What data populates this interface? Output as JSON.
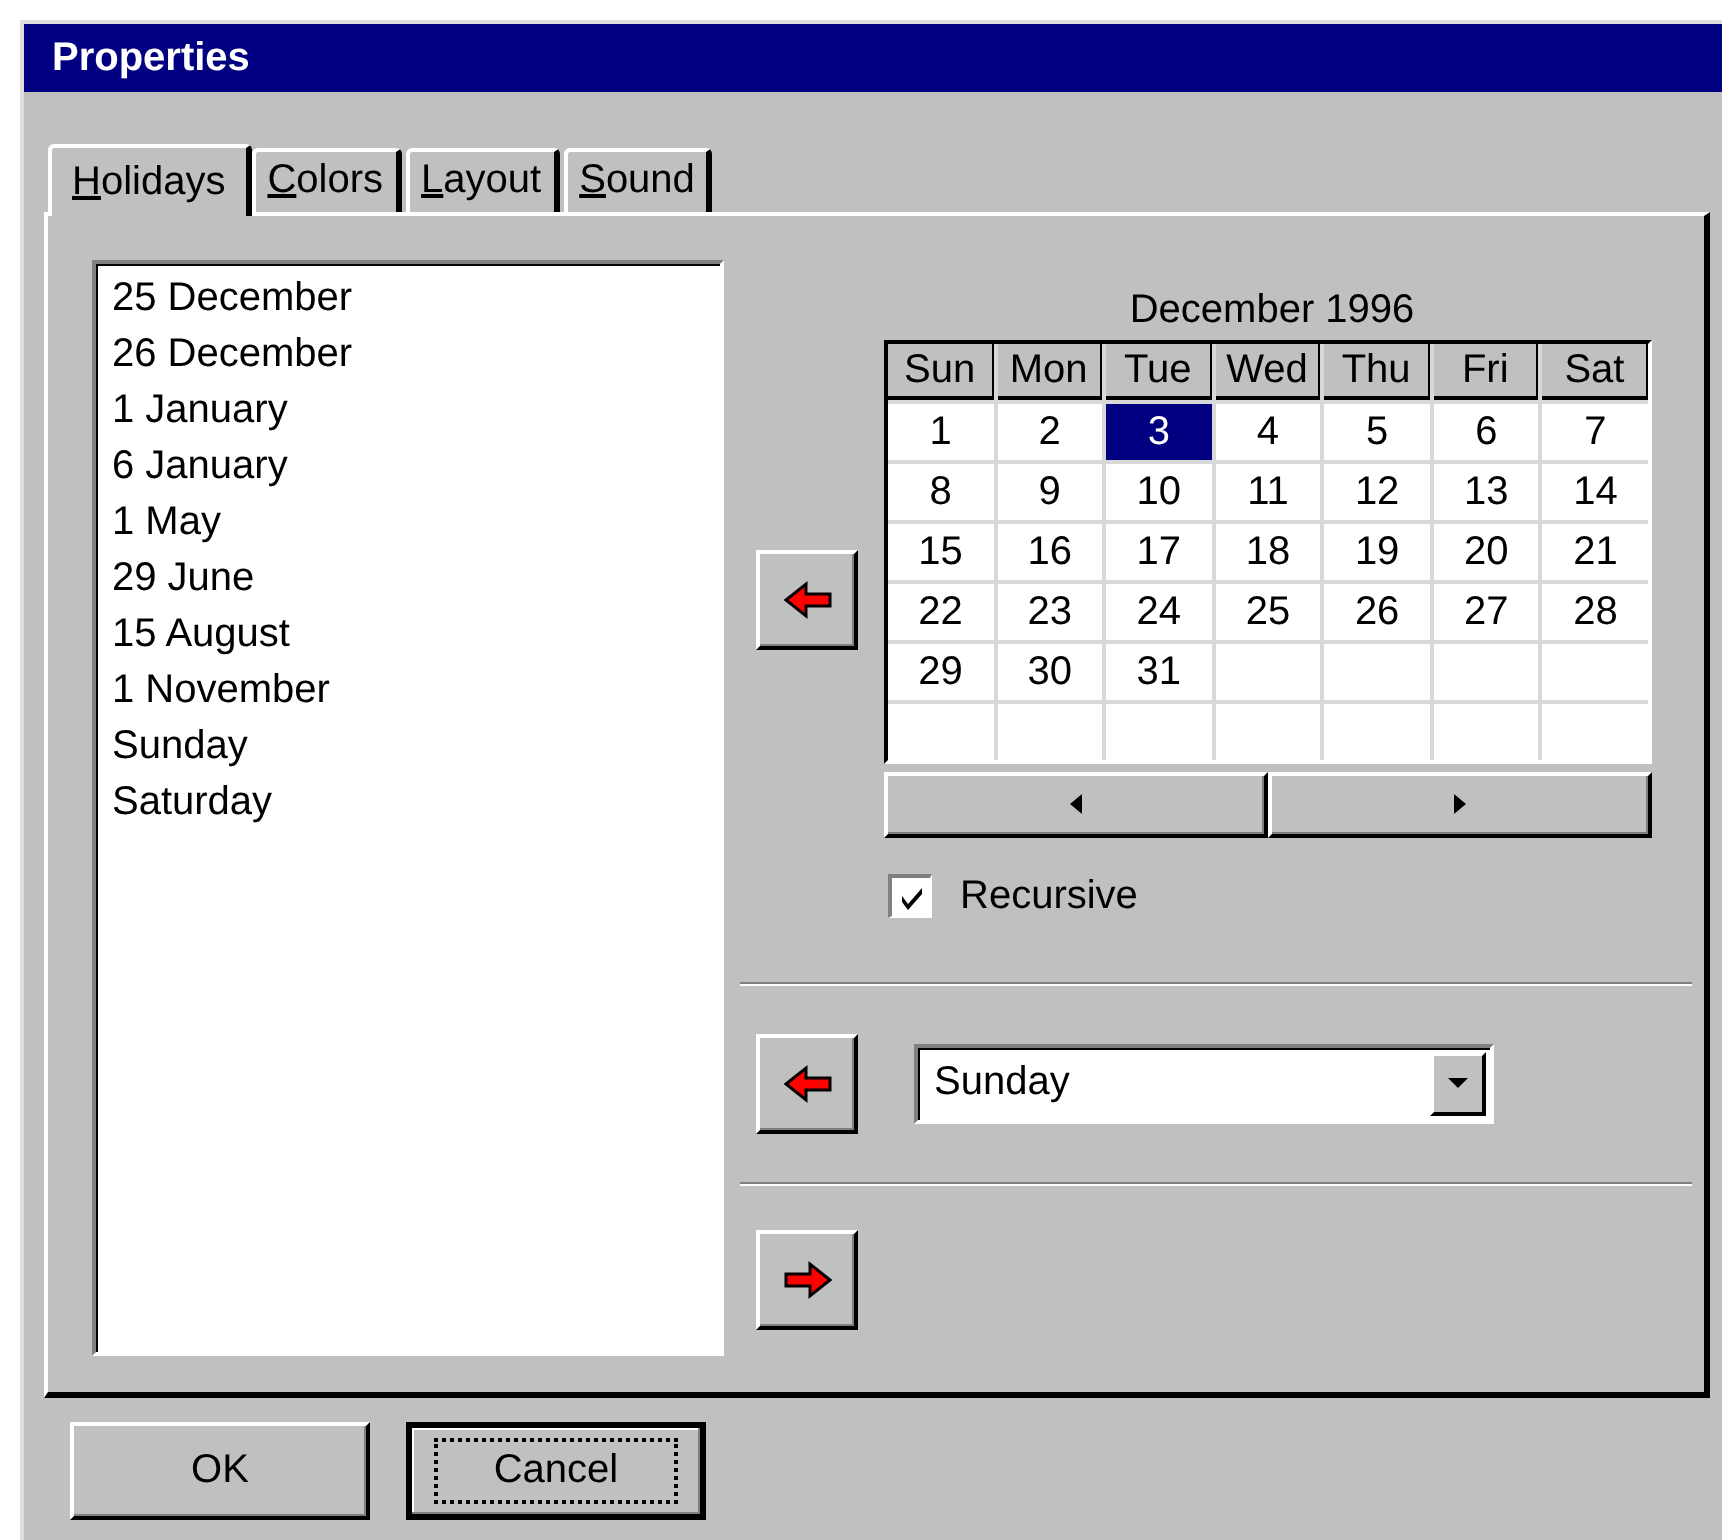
{
  "window": {
    "title": "Properties"
  },
  "tabs": [
    {
      "label": "Holidays",
      "selected": true
    },
    {
      "label": "Colors",
      "selected": false
    },
    {
      "label": "Layout",
      "selected": false
    },
    {
      "label": "Sound",
      "selected": false
    }
  ],
  "holiday_list": {
    "items": [
      "25 December",
      "26 December",
      "1 January",
      "6 January",
      "1 May",
      "29 June",
      "15 August",
      "1 November",
      "Sunday",
      "Saturday"
    ]
  },
  "date_section": {
    "add_button": {
      "kind": "left"
    },
    "calendar": {
      "title": "December 1996",
      "weekdays": [
        "Sun",
        "Mon",
        "Tue",
        "Wed",
        "Thu",
        "Fri",
        "Sat"
      ],
      "weeks": [
        [
          {
            "day": "1",
            "selected": false
          },
          {
            "day": "2",
            "selected": false
          },
          {
            "day": "3",
            "selected": true
          },
          {
            "day": "4",
            "selected": false
          },
          {
            "day": "5",
            "selected": false
          },
          {
            "day": "6",
            "selected": false
          },
          {
            "day": "7",
            "selected": false
          }
        ],
        [
          {
            "day": "8",
            "selected": false
          },
          {
            "day": "9",
            "selected": false
          },
          {
            "day": "10",
            "selected": false
          },
          {
            "day": "11",
            "selected": false
          },
          {
            "day": "12",
            "selected": false
          },
          {
            "day": "13",
            "selected": false
          },
          {
            "day": "14",
            "selected": false
          }
        ],
        [
          {
            "day": "15",
            "selected": false
          },
          {
            "day": "16",
            "selected": false
          },
          {
            "day": "17",
            "selected": false
          },
          {
            "day": "18",
            "selected": false
          },
          {
            "day": "19",
            "selected": false
          },
          {
            "day": "20",
            "selected": false
          },
          {
            "day": "21",
            "selected": false
          }
        ],
        [
          {
            "day": "22",
            "selected": false
          },
          {
            "day": "23",
            "selected": false
          },
          {
            "day": "24",
            "selected": false
          },
          {
            "day": "25",
            "selected": false
          },
          {
            "day": "26",
            "selected": false
          },
          {
            "day": "27",
            "selected": false
          },
          {
            "day": "28",
            "selected": false
          }
        ],
        [
          {
            "day": "29",
            "selected": false
          },
          {
            "day": "30",
            "selected": false
          },
          {
            "day": "31",
            "selected": false
          }
        ]
      ]
    },
    "recursive": {
      "label": "Recursive",
      "checked": true
    }
  },
  "weekday_section": {
    "add_button": {
      "kind": "left"
    },
    "weekday_combo": {
      "value": "Sunday"
    }
  },
  "remove_section": {
    "remove_button": {
      "kind": "right"
    }
  },
  "buttons": [
    {
      "label": "OK",
      "focused": false
    },
    {
      "label": "Cancel",
      "focused": true
    }
  ]
}
